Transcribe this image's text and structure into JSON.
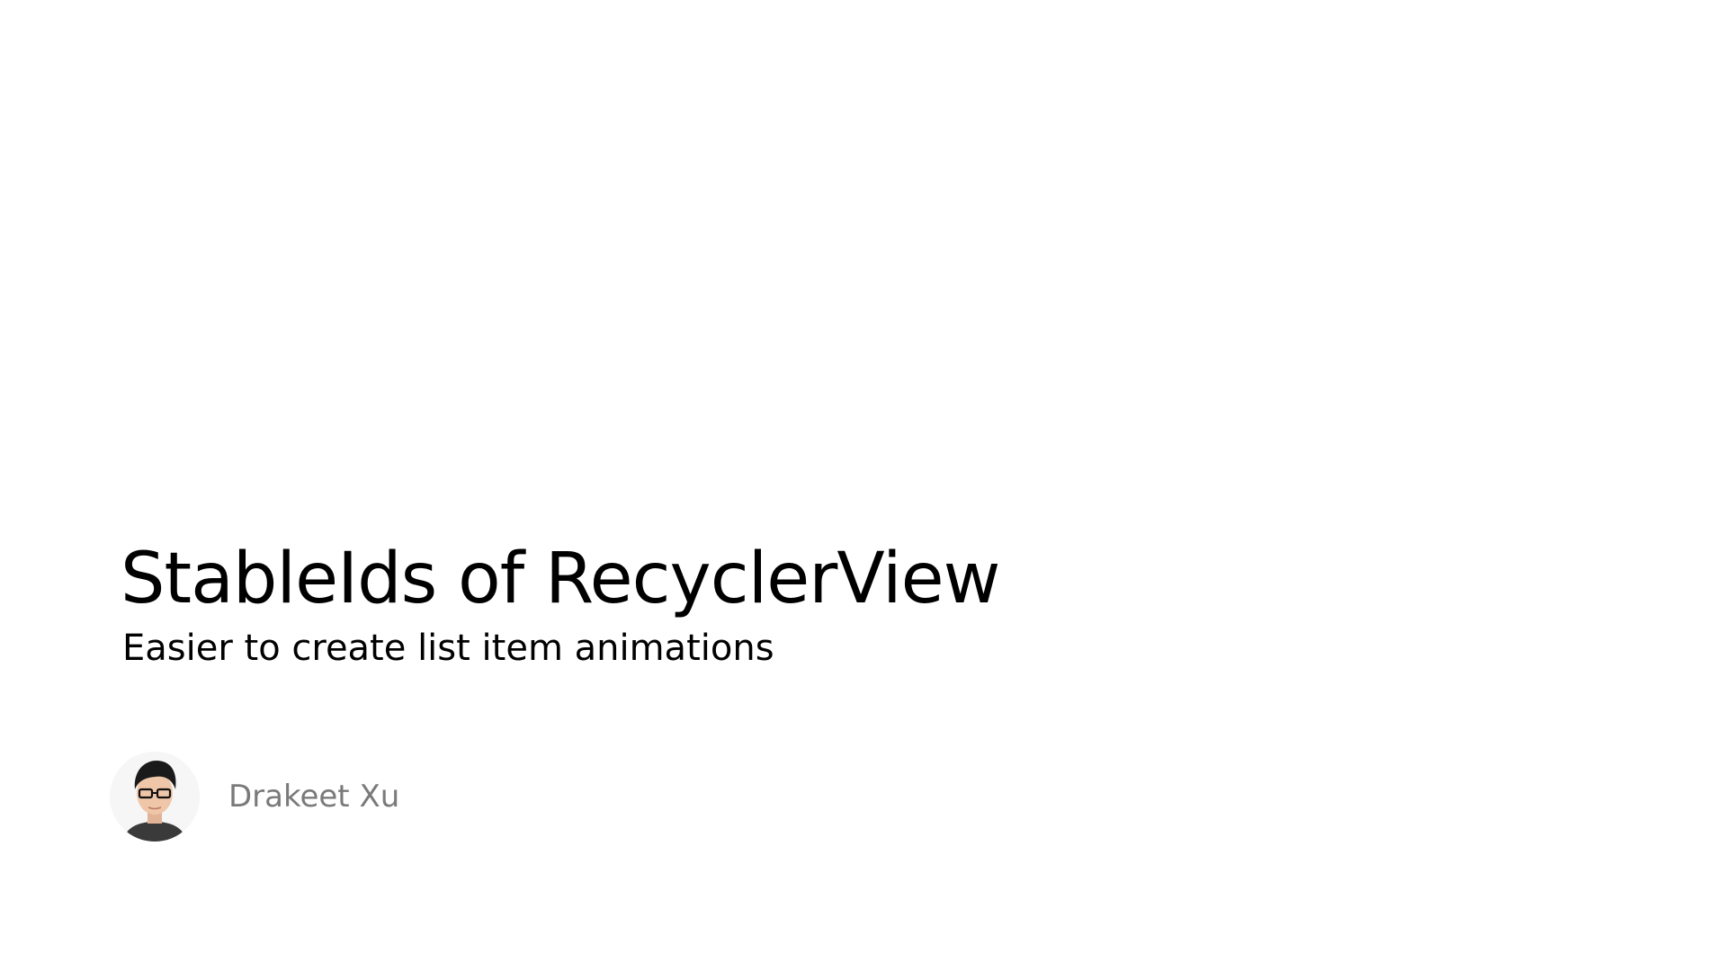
{
  "slide": {
    "title": "StableIds of RecyclerView",
    "subtitle": "Easier to create list item animations",
    "author": {
      "name": "Drakeet Xu",
      "avatar_icon": "person-avatar-icon"
    }
  },
  "colors": {
    "background": "#ffffff",
    "title": "#000000",
    "subtitle": "#000000",
    "author_name": "#7a7a7a"
  }
}
